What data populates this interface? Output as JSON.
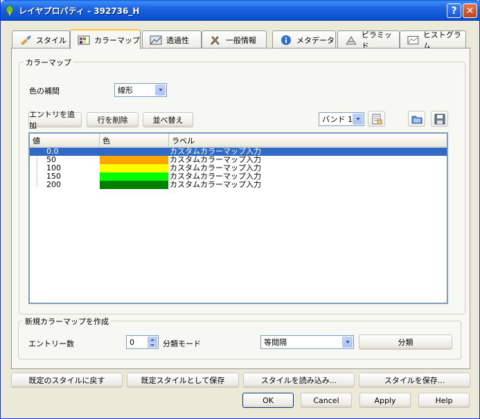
{
  "window": {
    "title": "レイヤプロパティ - 392736_H",
    "help_label": "?",
    "close_label": "✕"
  },
  "tabs": [
    {
      "label": "スタイル",
      "icon": "brush-icon"
    },
    {
      "label": "カラーマップ",
      "icon": "colormap-icon",
      "active": true
    },
    {
      "label": "透過性",
      "icon": "transparency-icon"
    },
    {
      "label": "一般情報",
      "icon": "tools-icon"
    },
    {
      "label": "メタデータ",
      "icon": "info-icon"
    },
    {
      "label": "ピラミッド",
      "icon": "pyramid-icon"
    },
    {
      "label": "ヒストグラム",
      "icon": "histogram-icon"
    }
  ],
  "colormap": {
    "group_title": "カラーマップ",
    "interp_label": "色の補間",
    "interp_value": "線形",
    "add_entry": "エントリを追加",
    "delete_row": "行を削除",
    "sort": "並べ替え",
    "band_value": "バンド 1",
    "columns": [
      "値",
      "色",
      "ラベル"
    ],
    "rows": [
      {
        "value": "0.0",
        "color": "#ffffff",
        "label": "カスタムカラーマップ入力",
        "selected": true
      },
      {
        "value": "50",
        "color": "#ffa500",
        "label": "カスタムカラーマップ入力"
      },
      {
        "value": "100",
        "color": "#ffff00",
        "label": "カスタムカラーマップ入力"
      },
      {
        "value": "150",
        "color": "#00ff00",
        "label": "カスタムカラーマップ入力"
      },
      {
        "value": "200",
        "color": "#008000",
        "label": "カスタムカラーマップ入力"
      }
    ]
  },
  "new_colormap": {
    "group_title": "新規カラーマップを作成",
    "entries_label": "エントリー数",
    "entries_value": "0",
    "mode_label": "分類モード",
    "mode_value": "等間隔",
    "classify": "分類"
  },
  "footer": {
    "restore_default": "既定のスタイルに戻す",
    "save_as_default": "既定スタイルとして保存",
    "load_style": "スタイルを読み込み...",
    "save_style": "スタイルを保存...",
    "ok": "OK",
    "cancel": "Cancel",
    "apply": "Apply",
    "help": "Help"
  }
}
